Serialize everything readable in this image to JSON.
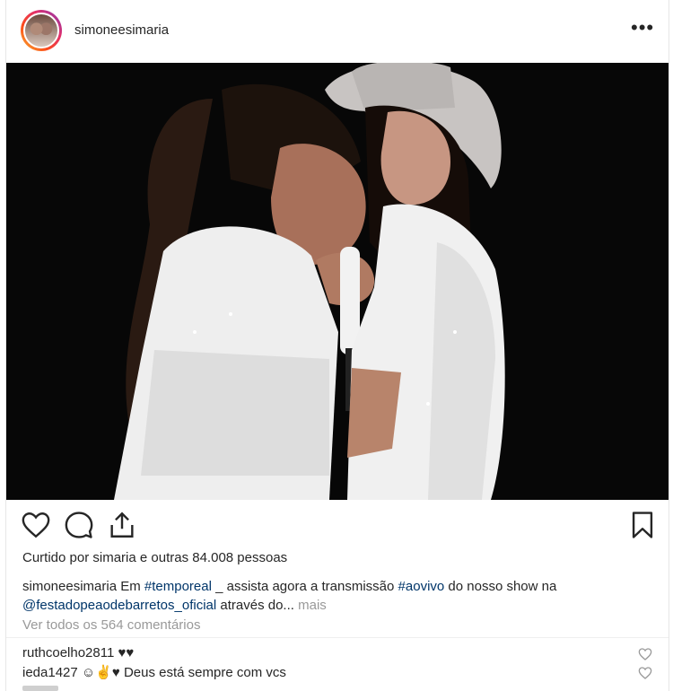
{
  "post": {
    "username": "simoneesimaria",
    "more_label": "•••"
  },
  "photo": {
    "alt": ""
  },
  "likes_text": "Curtido por simaria e outras 84.008 pessoas",
  "caption": {
    "username": "simoneesimaria",
    "part1": " Em ",
    "tag1": "#temporeal",
    "part2": " _ assista agora a transmissão ",
    "tag2": "#aovivo",
    "part3": " do nosso show na ",
    "mention": "@festadopeaodebarretos_oficial",
    "part4": " através do...",
    "more": " mais"
  },
  "view_all": "Ver todos os 564 comentários",
  "comments": [
    {
      "username": "ruthcoelho2811",
      "text": " ♥♥"
    },
    {
      "username": "ieda1427",
      "text": " ☺✌♥ Deus está sempre com vcs"
    }
  ]
}
